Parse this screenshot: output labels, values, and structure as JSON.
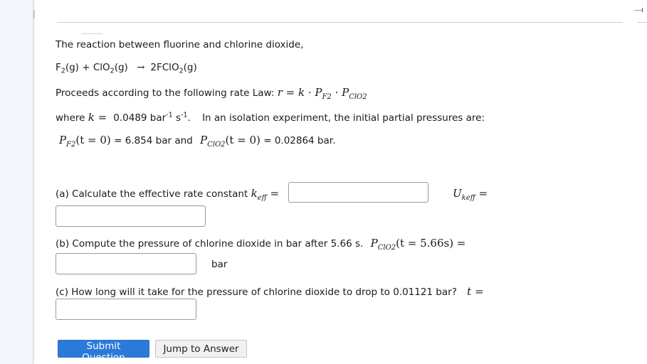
{
  "problem": {
    "intro": "The reaction between fluorine and chlorine dioxide,",
    "equation": {
      "reactant1": "F",
      "reactant1_sub": "2",
      "reactant1_state": "(g)",
      "plus": " + ",
      "reactant2": "ClO",
      "reactant2_sub": "2",
      "reactant2_state": "(g)",
      "arrow": "→",
      "product": "2FClO",
      "product_sub": "2",
      "product_state": "(g)"
    },
    "rate_law_prefix": "Proceeds according to the following rate Law:",
    "rate_law_math": {
      "r": "r",
      "eq": " = ",
      "k": "k",
      "dot": " · ",
      "P": "P",
      "sub_f2": "F2",
      "sub_clo2": "ClO2"
    },
    "where_prefix": "where",
    "k_symbol": "k",
    "k_eq": " = ",
    "k_value": "0.0489 bar",
    "k_unit_exp1": "-1",
    "k_unit_s": " s",
    "k_unit_exp2": "-1",
    "k_suffix": ".",
    "isolation_text": "In an isolation experiment, the initial partial pressures are:",
    "initial": {
      "pf2_label_P": "P",
      "pf2_label_sub": "F2",
      "pf2_arg": "(t = 0)",
      "pf2_value": " = 6.854 bar and",
      "pclo2_label_P": "P",
      "pclo2_label_sub": "ClO2",
      "pclo2_arg": "(t = 0)",
      "pclo2_value": " = 0.02864 bar."
    }
  },
  "parts": {
    "a": {
      "text": "(a) Calculate the effective rate constant",
      "k_sym": "k",
      "k_sub": "eff",
      "eq": " =",
      "u_sym": "U",
      "u_sub": "keff",
      "u_eq": " =",
      "input1_value": "",
      "input2_value": ""
    },
    "b": {
      "text": "(b) Compute the pressure of chlorine dioxide in bar after 5.66 s.",
      "P": "P",
      "sub": "ClO2",
      "arg": "(t = 5.66s) =",
      "input_value": "",
      "unit": "bar"
    },
    "c": {
      "text": "(c) How long will it take for the pressure of chlorine dioxide to drop to 0.01121 bar?",
      "t_sym": "t",
      "eq": " =",
      "input_value": ""
    }
  },
  "buttons": {
    "submit": "Submit Question",
    "jump": "Jump to Answer"
  }
}
